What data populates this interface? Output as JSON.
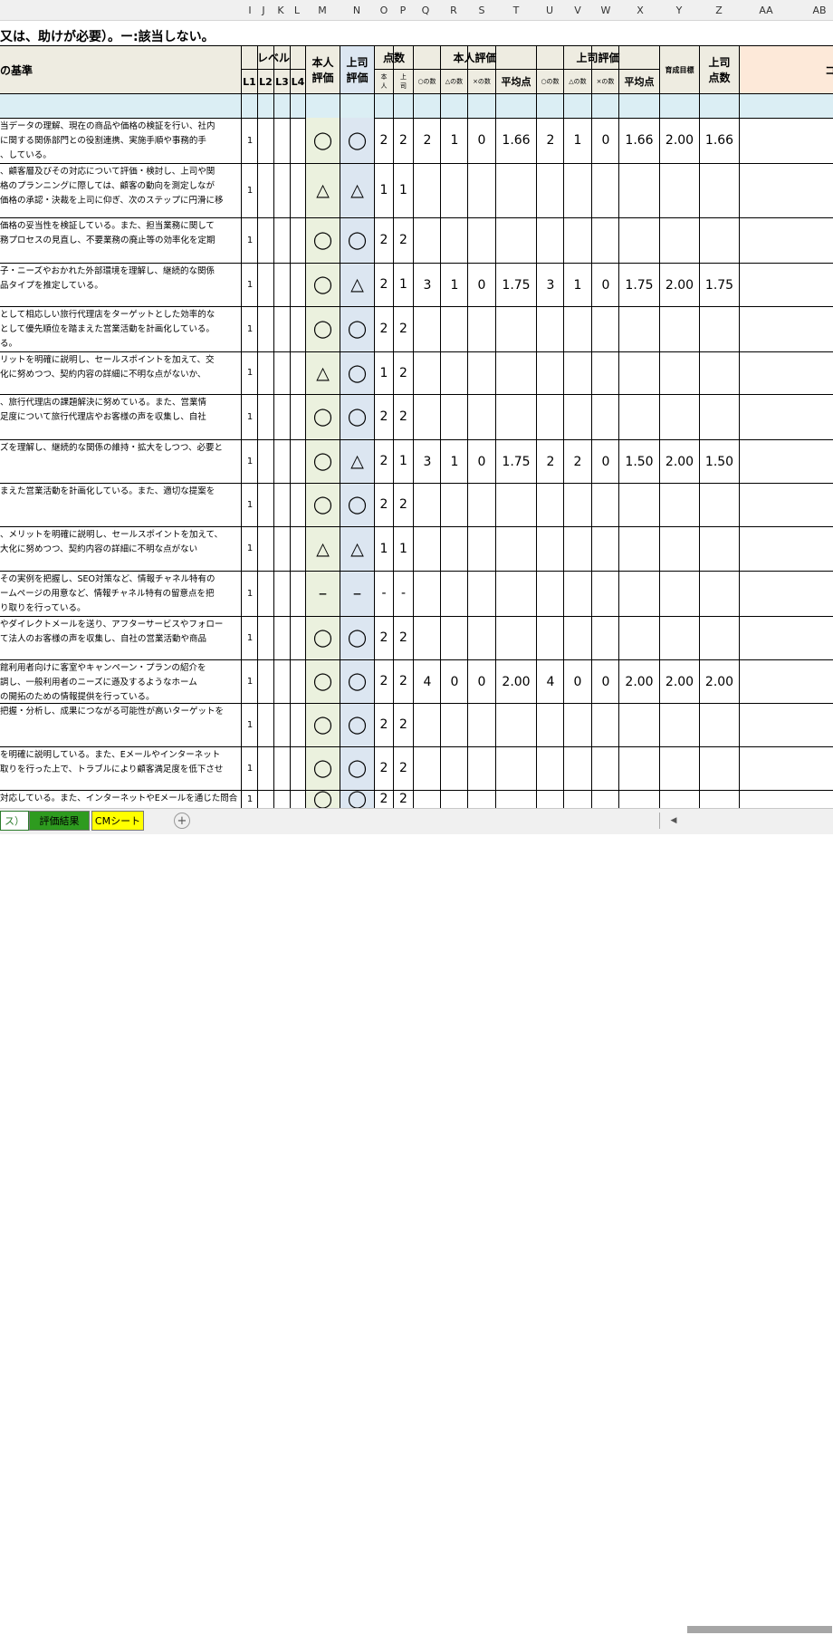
{
  "columns": [
    "I",
    "J",
    "K",
    "L",
    "M",
    "N",
    "O",
    "P",
    "Q",
    "R",
    "S",
    "T",
    "U",
    "V",
    "W",
    "X",
    "Y",
    "Z",
    "AA",
    "AB"
  ],
  "title": "又は、助けが必要）。ー:該当しない。",
  "header": {
    "criteria": "の基準",
    "level": "レベル",
    "levels": [
      "L1",
      "L2",
      "L3",
      "L4"
    ],
    "self_eval": "本人\n評価",
    "boss_eval": "上司\n評価",
    "points": "点数",
    "points_self": "本\n人",
    "points_boss": "上\n司",
    "self_section": "本人評価",
    "boss_section": "上司評価",
    "count_o": "○の数",
    "count_tri": "△の数",
    "count_x": "×の数",
    "avg": "平均点",
    "target": "育成目標",
    "boss_score": "上司\n点数",
    "comment": "コ"
  },
  "rows": [
    {
      "text": [
        "当データの理解、現在の商品や価格の検証を行い、社内",
        "に関する関係部門との役割連携、実施手順や事務的手",
        "、している。"
      ],
      "l1": "1",
      "self": "◯",
      "boss": "◯",
      "ps": "2",
      "pb": "2",
      "stats": {
        "so": "2",
        "st": "1",
        "sx": "0",
        "savg": "1.66",
        "bo": "2",
        "bt": "1",
        "bx": "0",
        "bavg": "1.66",
        "target": "2.00",
        "bscore": "1.66"
      }
    },
    {
      "text": [
        "、顧客層及びその対応について評価・検討し、上司や関",
        "格のプランニングに際しては、顧客の動向を測定しなが",
        "価格の承認・決裁を上司に仰ぎ、次のステップに円滑に移"
      ],
      "l1": "1",
      "self": "△",
      "boss": "△",
      "ps": "1",
      "pb": "1"
    },
    {
      "text": [
        "価格の妥当性を検証している。また、担当業務に関して",
        "務プロセスの見直し、不要業務の廃止等の効率化を定期"
      ],
      "l1": "1",
      "self": "◯",
      "boss": "◯",
      "ps": "2",
      "pb": "2"
    },
    {
      "text": [
        "子・ニーズやおかれた外部環境を理解し、継続的な関係",
        "品タイプを推定している。"
      ],
      "l1": "1",
      "self": "◯",
      "boss": "△",
      "ps": "2",
      "pb": "1",
      "stats": {
        "so": "3",
        "st": "1",
        "sx": "0",
        "savg": "1.75",
        "bo": "3",
        "bt": "1",
        "bx": "0",
        "bavg": "1.75",
        "target": "2.00",
        "bscore": "1.75"
      }
    },
    {
      "text": [
        "として相応しい旅行代理店をターゲットとした効率的な",
        "として優先順位を踏まえた営業活動を計画化している。",
        "る。"
      ],
      "l1": "1",
      "self": "◯",
      "boss": "◯",
      "ps": "2",
      "pb": "2"
    },
    {
      "text": [
        "リットを明確に説明し、セールスポイントを加えて、交",
        "化に努めつつ、契約内容の詳細に不明な点がないか、"
      ],
      "l1": "1",
      "self": "△",
      "boss": "◯",
      "ps": "1",
      "pb": "2"
    },
    {
      "text": [
        "、旅行代理店の課題解決に努めている。また、営業情",
        "足度について旅行代理店やお客様の声を収集し、自社"
      ],
      "l1": "1",
      "self": "◯",
      "boss": "◯",
      "ps": "2",
      "pb": "2"
    },
    {
      "text": [
        "ズを理解し、継続的な関係の維持・拡大をしつつ、必要と"
      ],
      "l1": "1",
      "self": "◯",
      "boss": "△",
      "ps": "2",
      "pb": "1",
      "stats": {
        "so": "3",
        "st": "1",
        "sx": "0",
        "savg": "1.75",
        "bo": "2",
        "bt": "2",
        "bx": "0",
        "bavg": "1.50",
        "target": "2.00",
        "bscore": "1.50"
      }
    },
    {
      "text": [
        "まえた営業活動を計画化している。また、適切な提案を"
      ],
      "l1": "1",
      "self": "◯",
      "boss": "◯",
      "ps": "2",
      "pb": "2"
    },
    {
      "text": [
        "、メリットを明確に説明し、セールスポイントを加えて、",
        "大化に努めつつ、契約内容の詳細に不明な点がない"
      ],
      "l1": "1",
      "self": "△",
      "boss": "△",
      "ps": "1",
      "pb": "1"
    },
    {
      "text": [
        "その実例を把握し、SEO対策など、情報チャネル特有の",
        "ームページの用意など、情報チャネル特有の留意点を把",
        "り取りを行っている。"
      ],
      "l1": "1",
      "self": "–",
      "boss": "–",
      "ps": "-",
      "pb": "-"
    },
    {
      "text": [
        "やダイレクトメールを送り、アフターサービスやフォロー",
        "て法人のお客様の声を収集し、自社の営業活動や商品"
      ],
      "l1": "1",
      "self": "◯",
      "boss": "◯",
      "ps": "2",
      "pb": "2"
    },
    {
      "text": [
        "館利用者向けに客室やキャンペーン・プランの紹介を",
        "調し、一般利用者のニーズに遜及するようなホーム",
        "の開拓のための情報提供を行っている。"
      ],
      "l1": "1",
      "self": "◯",
      "boss": "◯",
      "ps": "2",
      "pb": "2",
      "stats": {
        "so": "4",
        "st": "0",
        "sx": "0",
        "savg": "2.00",
        "bo": "4",
        "bt": "0",
        "bx": "0",
        "bavg": "2.00",
        "target": "2.00",
        "bscore": "2.00"
      }
    },
    {
      "text": [
        "把握・分析し、成果につながる可能性が高いターゲットを"
      ],
      "l1": "1",
      "self": "◯",
      "boss": "◯",
      "ps": "2",
      "pb": "2"
    },
    {
      "text": [
        "を明確に説明している。また、Eメールやインターネット",
        "取りを行った上で、トラブルにより顧客満足度を低下させ"
      ],
      "l1": "1",
      "self": "◯",
      "boss": "◯",
      "ps": "2",
      "pb": "2"
    },
    {
      "text": [
        "対応している。また、インターネットやEメールを通じた問合"
      ],
      "l1": "1",
      "self": "◯",
      "boss": "◯",
      "ps": "2",
      "pb": "2"
    }
  ],
  "tabs": {
    "partial": "ス）",
    "result": "評価結果",
    "cm": "CMシート",
    "add": "+"
  }
}
